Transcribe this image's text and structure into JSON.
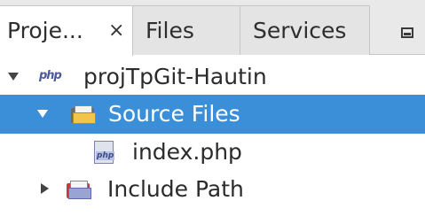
{
  "tabs": [
    {
      "label": "Proje...",
      "close": "×",
      "active": true
    },
    {
      "label": "Files",
      "active": false
    },
    {
      "label": "Services",
      "active": false
    }
  ],
  "tree": {
    "items": [
      {
        "label": "projTpGit-Hautin",
        "icon": "php-project-icon",
        "expanded": true,
        "level": 0
      },
      {
        "label": "Source Files",
        "icon": "source-folder-icon",
        "expanded": true,
        "level": 1,
        "selected": true
      },
      {
        "label": "index.php",
        "icon": "php-file-icon",
        "level": 2
      },
      {
        "label": "Include Path",
        "icon": "library-folder-icon",
        "expanded": false,
        "level": 1
      }
    ],
    "php_badge": "php"
  },
  "colors": {
    "selection": "#3b8fd9",
    "tabbar": "#e9e9e9",
    "folder": "#f0c54a"
  }
}
